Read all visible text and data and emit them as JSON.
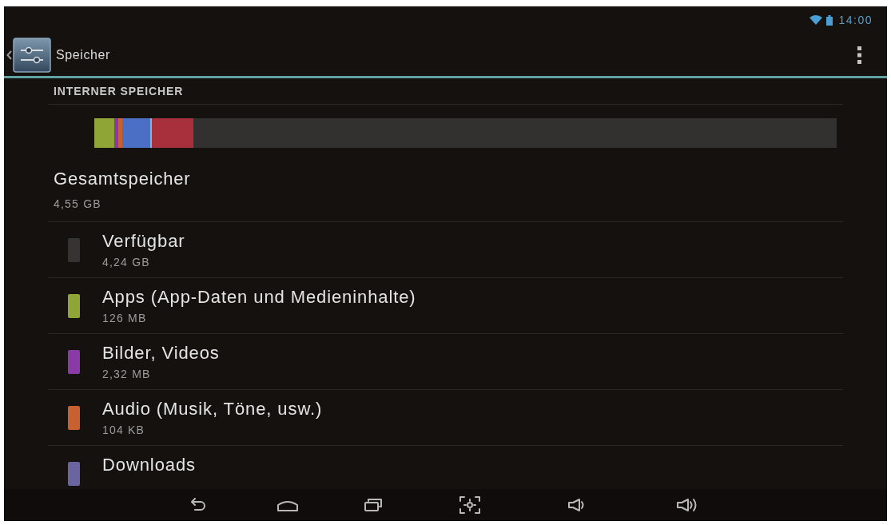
{
  "status_bar": {
    "time": "14:00"
  },
  "action_bar": {
    "title": "Speicher"
  },
  "section": {
    "heading": "INTERNER SPEICHER"
  },
  "usage_bar": {
    "segments": [
      {
        "color": "#8fa536",
        "level": 0.027
      },
      {
        "color": "#8a3aa6",
        "level": 0.005
      },
      {
        "color": "#c8612f",
        "level": 0.006
      },
      {
        "color": "#4a6fc4",
        "level": 0.037
      },
      {
        "color": "#7fb4dc",
        "level": 0.003
      },
      {
        "color": "#a8303c",
        "level": 0.056
      }
    ]
  },
  "total": {
    "label": "Gesamtspeicher",
    "value": "4,55 GB"
  },
  "categories": [
    {
      "name": "Verfügbar",
      "size": "4,24 GB",
      "color": "#363433"
    },
    {
      "name": "Apps (App-Daten und Medieninhalte)",
      "size": "126 MB",
      "color": "#8fa536"
    },
    {
      "name": "Bilder, Videos",
      "size": "2,32 MB",
      "color": "#8a3aa6"
    },
    {
      "name": "Audio (Musik, Töne, usw.)",
      "size": "104 KB",
      "color": "#c8612f"
    },
    {
      "name": "Downloads",
      "color": "#6a64a0"
    }
  ]
}
